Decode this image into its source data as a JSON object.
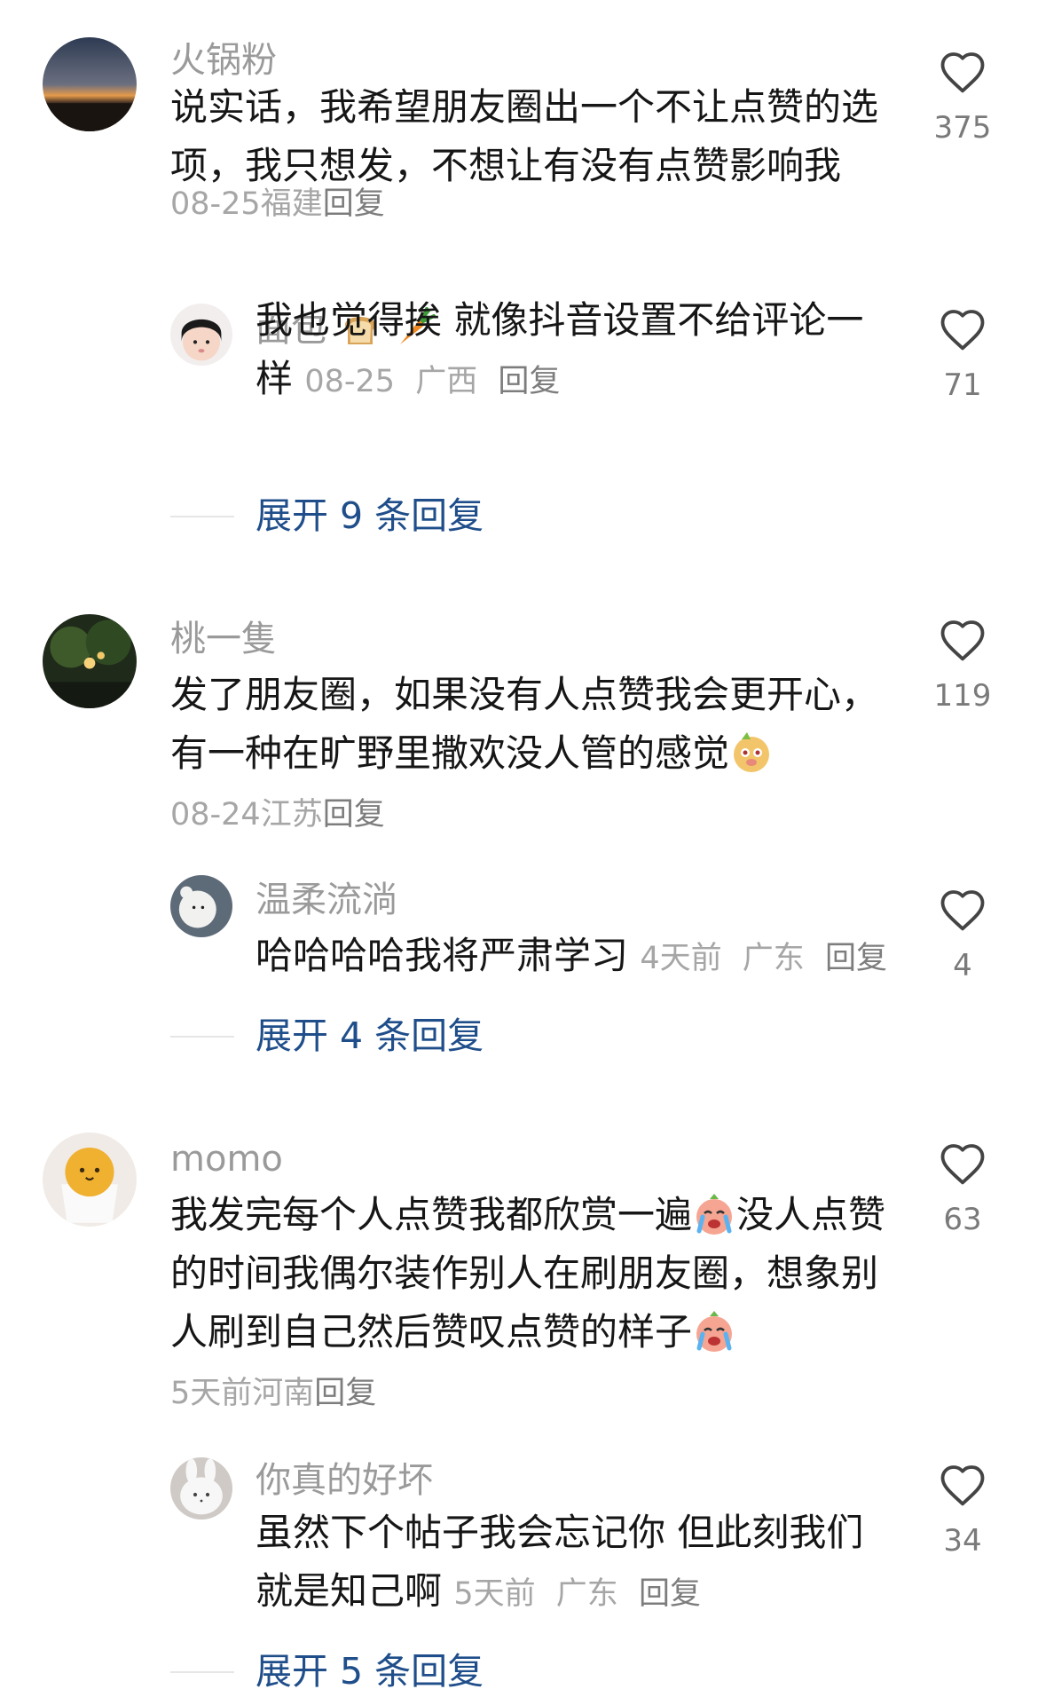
{
  "comments": [
    {
      "username": "火锅粉",
      "text": "说实话，我希望朋友圈出一个不让点赞的选项，我只想发，不想让有没有点赞影响我",
      "time": "08-25",
      "location": "福建",
      "reply_label": "回复",
      "likes": "375",
      "reply": {
        "username": "面包",
        "username_emoji": [
          "bread-emoji",
          "carrot-emoji"
        ],
        "text": "我也觉得挨  就像抖音设置不给评论一样",
        "time": "08-25",
        "location": "广西",
        "reply_label": "回复",
        "likes": "71"
      },
      "expand_label": "展开 9 条回复"
    },
    {
      "username": "桃一隻",
      "text": "发了朋友圈，如果没有人点赞我会更开心，有一种在旷野里撒欢没人管的感觉",
      "text_emoji": "pig-face-emoji",
      "time": "08-24",
      "location": "江苏",
      "reply_label": "回复",
      "likes": "119",
      "reply": {
        "username": "温柔流淌",
        "text": "哈哈哈哈我将严肃学习",
        "time": "4天前",
        "location": "广东",
        "reply_label": "回复",
        "likes": "4"
      },
      "expand_label": "展开 4 条回复"
    },
    {
      "username": "momo",
      "text_part1": "我发完每个人点赞我都欣赏一遍",
      "text_part2": "没人点赞的时间我偶尔装作别人在刷朋友圈，想象别人刷到自己然后赞叹点赞的样子",
      "text_emoji": "crying-emoji",
      "time": "5天前",
      "location": "河南",
      "reply_label": "回复",
      "likes": "63",
      "reply": {
        "username": "你真的好坏",
        "text": "虽然下个帖子我会忘记你 但此刻我们就是知己啊",
        "time": "5天前",
        "location": "广东",
        "reply_label": "回复",
        "likes": "34"
      },
      "expand_label": "展开 5 条回复"
    }
  ],
  "colors": {
    "username": "#9a9a9a",
    "text": "#161616",
    "meta": "#a6a6a6",
    "expand": "#1f4e8a"
  },
  "icons": {
    "like": "heart-outline-icon"
  }
}
